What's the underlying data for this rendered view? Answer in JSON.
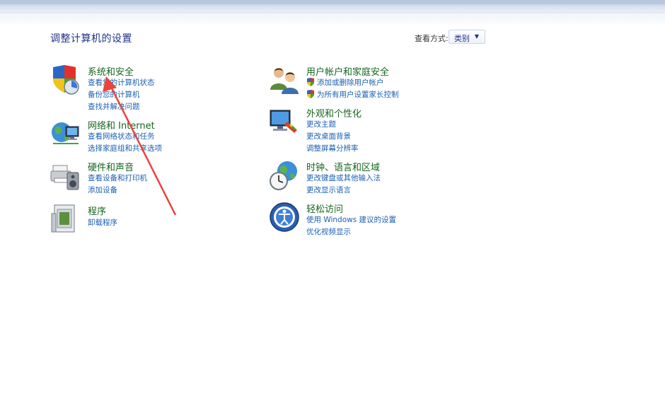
{
  "header": {
    "title": "调整计算机的设置",
    "view_by_label": "查看方式:",
    "view_by_value": "类别"
  },
  "left_categories": [
    {
      "title": "系统和安全",
      "icon": "shield-pc-icon",
      "links": [
        "查看您的计算机状态",
        "备份您的计算机",
        "查找并解决问题"
      ]
    },
    {
      "title": "网络和 Internet",
      "icon": "network-globe-icon",
      "links": [
        "查看网络状态和任务",
        "选择家庭组和共享选项"
      ]
    },
    {
      "title": "硬件和声音",
      "icon": "printer-speaker-icon",
      "links": [
        "查看设备和打印机",
        "添加设备"
      ]
    },
    {
      "title": "程序",
      "icon": "programs-icon",
      "links": [
        "卸载程序"
      ]
    }
  ],
  "right_categories": [
    {
      "title": "用户帐户和家庭安全",
      "icon": "users-icon",
      "links": [
        "添加或删除用户帐户",
        "为所有用户设置家长控制"
      ]
    },
    {
      "title": "外观和个性化",
      "icon": "appearance-icon",
      "links": [
        "更改主题",
        "更改桌面背景",
        "调整屏幕分辨率"
      ]
    },
    {
      "title": "时钟、语言和区域",
      "icon": "clock-globe-icon",
      "links": [
        "更改键盘或其他输入法",
        "更改显示语言"
      ]
    },
    {
      "title": "轻松访问",
      "icon": "ease-of-access-icon",
      "links": [
        "使用 Windows 建议的设置",
        "优化视频显示"
      ]
    }
  ],
  "colors": {
    "title_blue": "#1e3287",
    "category_green": "#16651d",
    "link_blue": "#1b5fb3",
    "annotation_red": "#e8453c"
  }
}
